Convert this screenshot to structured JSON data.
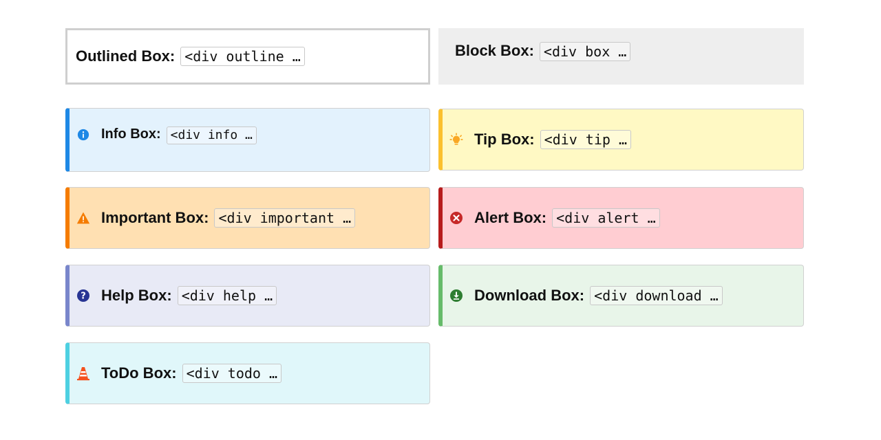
{
  "boxes": {
    "outlined": {
      "label": "Outlined Box:",
      "code": "<div outline …"
    },
    "block": {
      "label": "Block Box:",
      "code": "<div box …"
    },
    "info": {
      "label": "Info Box:",
      "code": "<div info …",
      "icon": "info-icon",
      "accent": "#1e88e5",
      "bg": "#e3f2fd"
    },
    "tip": {
      "label": "Tip Box:",
      "code": "<div tip …",
      "icon": "lightbulb-icon",
      "accent": "#fbc02d",
      "bg": "#fff9c4"
    },
    "important": {
      "label": "Important Box:",
      "code": "<div important …",
      "icon": "warning-icon",
      "accent": "#f57c00",
      "bg": "#ffe0b2"
    },
    "alert": {
      "label": "Alert Box:",
      "code": "<div alert …",
      "icon": "error-icon",
      "accent": "#b71c1c",
      "bg": "#ffcdd2"
    },
    "help": {
      "label": "Help Box:",
      "code": "<div help …",
      "icon": "help-icon",
      "accent": "#7986cb",
      "bg": "#e8eaf6"
    },
    "download": {
      "label": "Download Box:",
      "code": "<div download …",
      "icon": "download-icon",
      "accent": "#66bb6a",
      "bg": "#e8f5e9"
    },
    "todo": {
      "label": "ToDo Box:",
      "code": "<div todo …",
      "icon": "traffic-cone-icon",
      "accent": "#4dd0e1",
      "bg": "#e0f7fa"
    }
  }
}
